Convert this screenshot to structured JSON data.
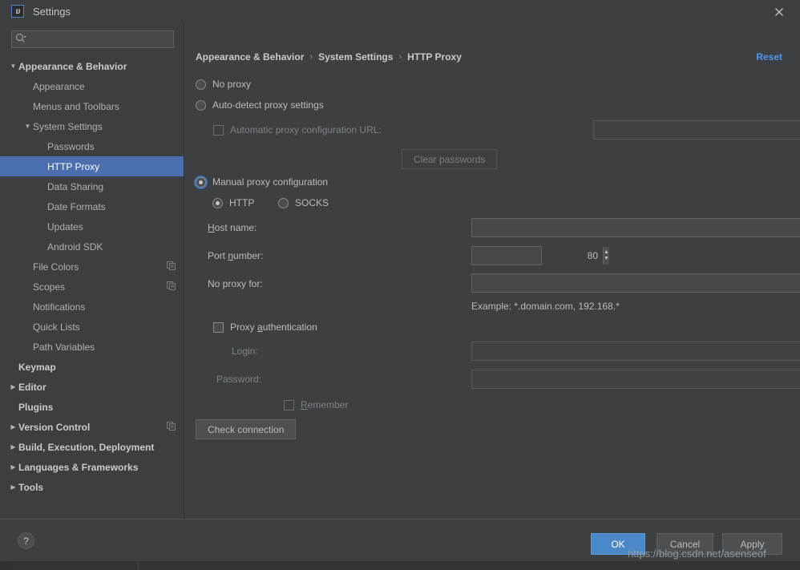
{
  "window": {
    "title": "Settings",
    "app_icon": "intellij-idea-icon",
    "close_icon": "close-icon"
  },
  "sidebar": {
    "search": {
      "placeholder": "",
      "value": "",
      "icon": "search-icon"
    },
    "items": [
      {
        "label": "Appearance & Behavior",
        "indent": 0,
        "arrow": "▼",
        "bold": true,
        "selected": false,
        "copy_icon": false
      },
      {
        "label": "Appearance",
        "indent": 1,
        "arrow": "",
        "bold": false,
        "selected": false,
        "copy_icon": false
      },
      {
        "label": "Menus and Toolbars",
        "indent": 1,
        "arrow": "",
        "bold": false,
        "selected": false,
        "copy_icon": false
      },
      {
        "label": "System Settings",
        "indent": 1,
        "arrow": "▼",
        "bold": false,
        "selected": false,
        "copy_icon": false
      },
      {
        "label": "Passwords",
        "indent": 2,
        "arrow": "",
        "bold": false,
        "selected": false,
        "copy_icon": false
      },
      {
        "label": "HTTP Proxy",
        "indent": 2,
        "arrow": "",
        "bold": false,
        "selected": true,
        "copy_icon": false
      },
      {
        "label": "Data Sharing",
        "indent": 2,
        "arrow": "",
        "bold": false,
        "selected": false,
        "copy_icon": false
      },
      {
        "label": "Date Formats",
        "indent": 2,
        "arrow": "",
        "bold": false,
        "selected": false,
        "copy_icon": false
      },
      {
        "label": "Updates",
        "indent": 2,
        "arrow": "",
        "bold": false,
        "selected": false,
        "copy_icon": false
      },
      {
        "label": "Android SDK",
        "indent": 2,
        "arrow": "",
        "bold": false,
        "selected": false,
        "copy_icon": false
      },
      {
        "label": "File Colors",
        "indent": 1,
        "arrow": "",
        "bold": false,
        "selected": false,
        "copy_icon": true
      },
      {
        "label": "Scopes",
        "indent": 1,
        "arrow": "",
        "bold": false,
        "selected": false,
        "copy_icon": true
      },
      {
        "label": "Notifications",
        "indent": 1,
        "arrow": "",
        "bold": false,
        "selected": false,
        "copy_icon": false
      },
      {
        "label": "Quick Lists",
        "indent": 1,
        "arrow": "",
        "bold": false,
        "selected": false,
        "copy_icon": false
      },
      {
        "label": "Path Variables",
        "indent": 1,
        "arrow": "",
        "bold": false,
        "selected": false,
        "copy_icon": false
      },
      {
        "label": "Keymap",
        "indent": 0,
        "arrow": "",
        "bold": true,
        "selected": false,
        "copy_icon": false
      },
      {
        "label": "Editor",
        "indent": 0,
        "arrow": "▶",
        "bold": true,
        "selected": false,
        "copy_icon": false
      },
      {
        "label": "Plugins",
        "indent": 0,
        "arrow": "",
        "bold": true,
        "selected": false,
        "copy_icon": false
      },
      {
        "label": "Version Control",
        "indent": 0,
        "arrow": "▶",
        "bold": true,
        "selected": false,
        "copy_icon": true
      },
      {
        "label": "Build, Execution, Deployment",
        "indent": 0,
        "arrow": "▶",
        "bold": true,
        "selected": false,
        "copy_icon": false
      },
      {
        "label": "Languages & Frameworks",
        "indent": 0,
        "arrow": "▶",
        "bold": true,
        "selected": false,
        "copy_icon": false
      },
      {
        "label": "Tools",
        "indent": 0,
        "arrow": "▶",
        "bold": true,
        "selected": false,
        "copy_icon": false
      }
    ]
  },
  "main": {
    "breadcrumb": {
      "part1": "Appearance & Behavior",
      "sep1": "›",
      "part2": "System Settings",
      "sep2": "›",
      "part3": "HTTP Proxy"
    },
    "reset_label": "Reset",
    "no_proxy": {
      "label": "No proxy",
      "checked": false
    },
    "auto_detect": {
      "label": "Auto-detect proxy settings",
      "checked": false
    },
    "auto_config_url": {
      "label": "Automatic proxy configuration URL:",
      "checked": false,
      "value": "",
      "placeholder": ""
    },
    "clear_passwords_label": "Clear passwords",
    "manual_proxy": {
      "label": "Manual proxy configuration",
      "checked": true
    },
    "protocol_http": {
      "label": "HTTP",
      "checked": true
    },
    "protocol_socks": {
      "label": "SOCKS",
      "checked": false
    },
    "host_name": {
      "label_pre": "H",
      "label_mn": "",
      "label_post": "ost name:",
      "value": "",
      "placeholder": ""
    },
    "host_name_label": "Host name:",
    "port_number_label": "Port number:",
    "port_number_value": "80",
    "no_proxy_for_label": "No proxy for:",
    "no_proxy_for_value": "",
    "no_proxy_for_expand_icon": "expand-icon",
    "example_text": "Example: *.domain.com, 192.168.*",
    "proxy_auth": {
      "label": "Proxy authentication",
      "checked": false
    },
    "login": {
      "label": "Login:",
      "value": ""
    },
    "password": {
      "label": "Password:",
      "value": ""
    },
    "remember": {
      "label": "Remember",
      "checked": false
    },
    "check_connection_label": "Check connection"
  },
  "footer": {
    "help_label": "?",
    "ok_label": "OK",
    "cancel_label": "Cancel",
    "apply_label": "Apply"
  },
  "watermark": "https://blog.csdn.net/asenseof",
  "colors": {
    "selection_blue": "#4b6eaf",
    "link_blue": "#5394ec",
    "ok_button_blue": "#4a88c7",
    "sidebar_bg": "#3c3f41",
    "panel_bg": "#3c4043"
  }
}
